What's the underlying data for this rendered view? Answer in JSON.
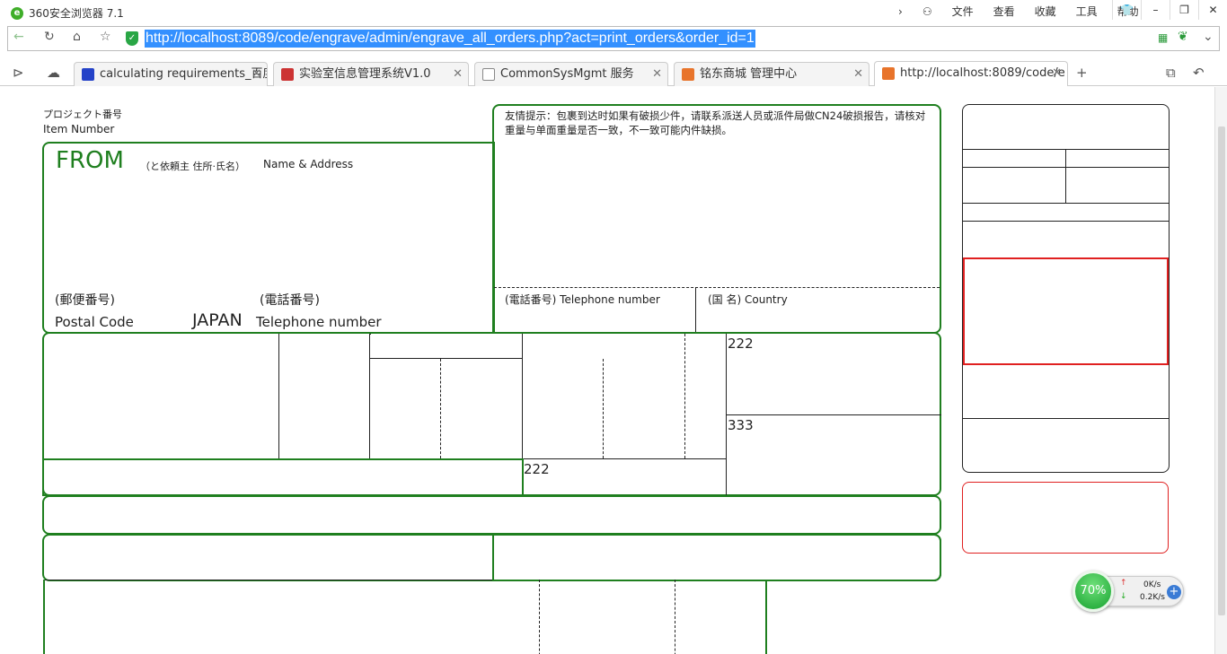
{
  "browser": {
    "title": "360安全浏览器 7.1",
    "menus": [
      "文件",
      "查看",
      "收藏",
      "工具",
      "帮助"
    ],
    "url": "http://localhost:8089/code/engrave/admin/engrave_all_orders.php?act=print_orders&order_id=1",
    "tabs": [
      {
        "label": "calculating requirements_百度"
      },
      {
        "label": "实验室信息管理系统V1.0"
      },
      {
        "label": "CommonSysMgmt 服务"
      },
      {
        "label": "铭东商城 管理中心"
      },
      {
        "label": "http://localhost:8089/code/e"
      }
    ]
  },
  "form": {
    "item_number_jp": "プロジェクト番号",
    "item_number_en": "Item Number",
    "from_title": "FROM",
    "from_sub_jp": "（と依頼主 住所·氏名）",
    "from_sub_en": "Name & Address",
    "postal_jp": "(郵便番号)",
    "postal_en": "Postal Code",
    "japan": "JAPAN",
    "phone_jp": "(電話番号)",
    "phone_en": "Telephone number",
    "notice": "友情提示：包裹到达时如果有破损少件，请联系派送人员或派件局做CN24破损报告，请核对重量与单面重量是否一致，不一致可能内件缺损。",
    "to_phone": "(電話番号) Telephone number",
    "to_country": "(国 名) Country",
    "value_a": "222",
    "value_b": "333",
    "value_c": "222"
  },
  "widget": {
    "percent": "70%",
    "up": "0K/s",
    "down": "0.2K/s"
  },
  "colors": {
    "form_border": "#1f7f1f",
    "highlight_border": "#e02020",
    "url_selection": "#3390ff"
  }
}
